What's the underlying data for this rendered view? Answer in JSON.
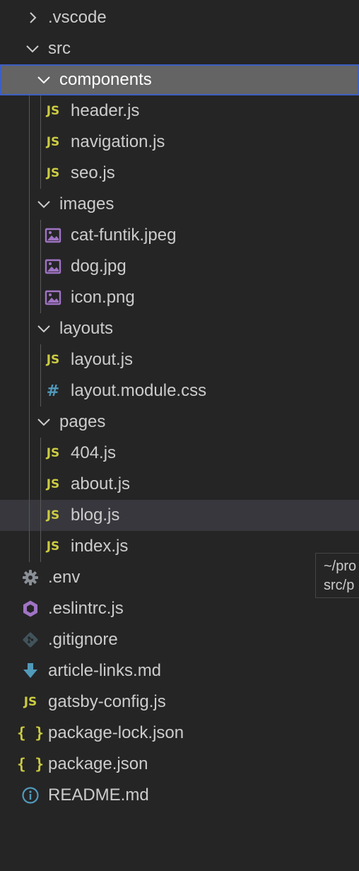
{
  "explorer": {
    "vscode": ".vscode",
    "src": "src",
    "components": "components",
    "header_js": "header.js",
    "navigation_js": "navigation.js",
    "seo_js": "seo.js",
    "images": "images",
    "cat_jpeg": "cat-funtik.jpeg",
    "dog_jpg": "dog.jpg",
    "icon_png": "icon.png",
    "layouts": "layouts",
    "layout_js": "layout.js",
    "layout_css": "layout.module.css",
    "pages": "pages",
    "p404_js": "404.js",
    "about_js": "about.js",
    "blog_js": "blog.js",
    "index_js": "index.js",
    "env": ".env",
    "eslintrc": ".eslintrc.js",
    "gitignore": ".gitignore",
    "article_links": "article-links.md",
    "gatsby_config": "gatsby-config.js",
    "package_lock": "package-lock.json",
    "package_json": "package.json",
    "readme": "README.md"
  },
  "icon_glyphs": {
    "js": "JS",
    "json": "{ }",
    "css": "#"
  },
  "tooltip": {
    "line1": "~/pro",
    "line2": "src/p"
  },
  "colors": {
    "background": "#252526",
    "selection": "#646464",
    "selection_border": "#3d5fc4",
    "hover": "#37373d",
    "js_icon": "#cbcb41",
    "image_icon": "#a074c4",
    "css_icon": "#519aba",
    "settings_icon": "#8a8f96",
    "eslint_icon": "#a074c4",
    "git_icon": "#41535b",
    "markdown_icon": "#519aba",
    "info_icon": "#519aba"
  }
}
